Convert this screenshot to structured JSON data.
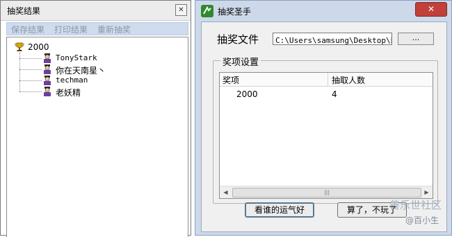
{
  "results_window": {
    "title": "抽奖结果",
    "close_icon": "close-icon",
    "menu": [
      "保存结果",
      "打印结果",
      "重新抽奖"
    ],
    "tree": {
      "root": "2000",
      "root_icon": "trophy-icon",
      "children": [
        "TonyStark",
        "你在天南星丶",
        "techman",
        "老妖精"
      ],
      "child_icon": "person-icon"
    }
  },
  "main_window": {
    "title": "抽奖圣手",
    "app_icon": "app-logo-icon",
    "close_icon": "close-icon",
    "file": {
      "label": "抽奖文件",
      "path": "C:\\Users\\samsung\\Desktop\\新建",
      "browse_label": "..."
    },
    "prize_settings": {
      "title": "奖项设置",
      "columns": [
        "奖项",
        "抽取人数"
      ],
      "rows": [
        [
          "2000",
          "4"
        ]
      ]
    },
    "buttons": {
      "lucky": "看谁的运气好",
      "quit": "算了，不玩了"
    }
  },
  "watermark": {
    "line1": "善乐世社区",
    "line2": "@百小生"
  },
  "colors": {
    "menubar": "#cfdcef",
    "main_frame": "#cdd9ea",
    "close_red": "#c2403a"
  }
}
